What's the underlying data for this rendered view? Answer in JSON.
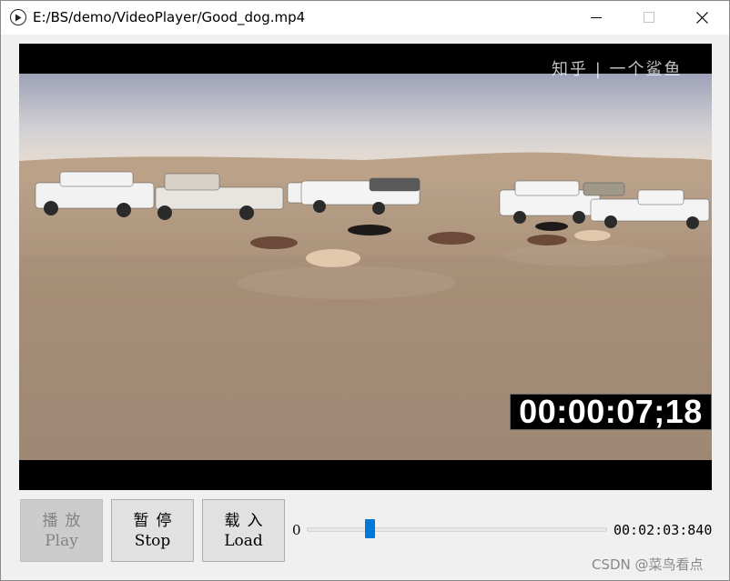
{
  "window": {
    "title": "E:/BS/demo/VideoPlayer/Good_dog.mp4"
  },
  "icons": {
    "app": "play-circle-icon",
    "minimize": "minimize-icon",
    "maximize": "maximize-icon",
    "close": "close-icon"
  },
  "video": {
    "timecode": "00:00:07;18",
    "watermark": "知乎 | 一个鲨鱼"
  },
  "controls": {
    "play": {
      "cn": "播放",
      "en": "Play",
      "enabled": false
    },
    "stop": {
      "cn": "暂停",
      "en": "Stop",
      "enabled": true
    },
    "load": {
      "cn": "载入",
      "en": "Load",
      "enabled": true
    }
  },
  "slider": {
    "position_label": "0",
    "fraction": 0.2,
    "duration": "00:02:03:840",
    "accent": "#0078d7"
  },
  "watermark": "CSDN @菜鸟看点"
}
